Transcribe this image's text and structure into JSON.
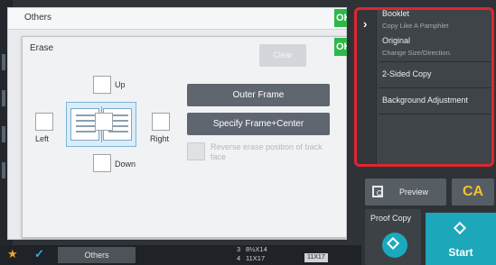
{
  "others_panel": {
    "title": "Others",
    "ok_label": "OK"
  },
  "erase_panel": {
    "title": "Erase",
    "ok_label": "OK",
    "clear_label": "Clear",
    "positions": {
      "up": "Up",
      "left": "Left",
      "right": "Right",
      "down": "Down"
    },
    "outer_frame_label": "Outer Frame",
    "frame_center_label": "Specify Frame+Center",
    "reverse_label": "Reverse erase position of back face"
  },
  "right_menu": {
    "expand_icon": "chevron-right-icon",
    "items": [
      {
        "label": "Booklet",
        "sublabel": "Copy Like A Pamphlet"
      },
      {
        "label": "Original",
        "sublabel": "Change Size/Direction."
      },
      {
        "label": "2-Sided Copy"
      },
      {
        "label": "Background Adjustment"
      }
    ],
    "highlight_color": "#e0262d"
  },
  "controls": {
    "preview_label": "Preview",
    "ca_label": "CA",
    "proof_copy_label": "Proof Copy",
    "start_label": "Start"
  },
  "taskbar": {
    "star_icon": "star-icon",
    "check_icon": "check-icon",
    "tab_label": "Others",
    "paper": {
      "row1_tray": "3",
      "row1_size": "8½X14",
      "row2_tray": "4",
      "row2_size": "11X17",
      "output_size": "11X17"
    }
  },
  "colors": {
    "start": "#1da7ba",
    "ok": "#2db84a",
    "ca": "#f2c230"
  }
}
